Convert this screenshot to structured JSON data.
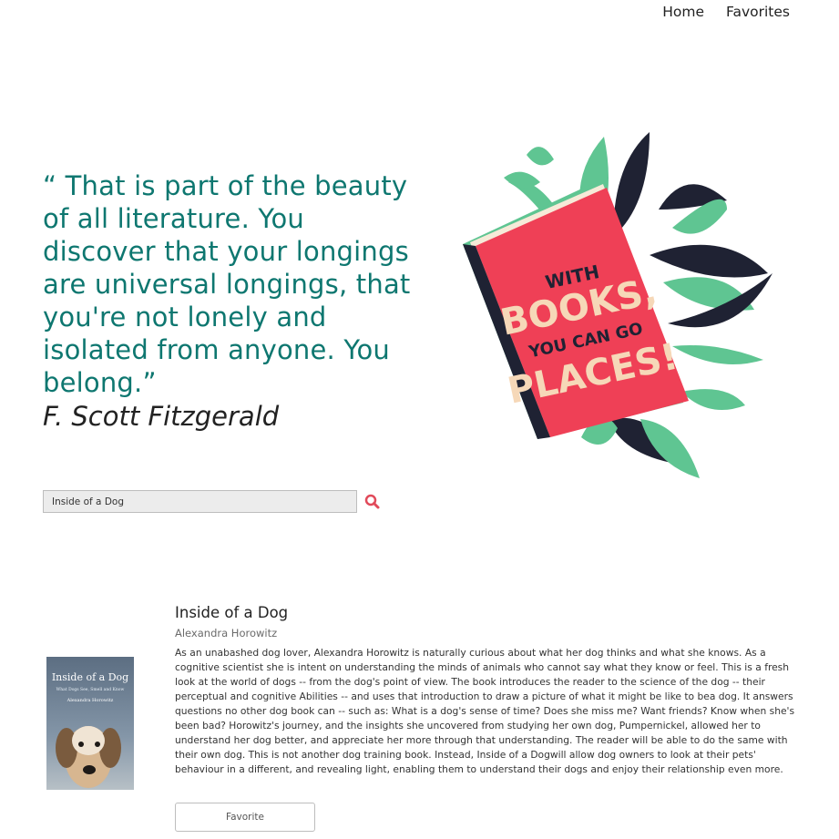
{
  "nav": {
    "home_label": "Home",
    "favorites_label": "Favorites"
  },
  "hero": {
    "quote": "“ That is part of the beauty of all literature. You discover that your longings are universal longings, that you're not lonely and isolated from anyone. You belong.”",
    "author": "F. Scott Fitzgerald",
    "illustration_text": [
      "WITH",
      "BOOKS,",
      "YOU CAN GO",
      "PLACES!"
    ]
  },
  "search": {
    "value": "Inside of a Dog",
    "icon": "search-icon"
  },
  "result": {
    "title": "Inside of a Dog",
    "author": "Alexandra Horowitz",
    "cover_title": "Inside of a Dog",
    "cover_subtitle": "What Dogs See, Smell and Know",
    "cover_author": "Alexandra Horowitz",
    "description": "As an unabashed dog lover, Alexandra Horowitz is naturally curious about what her dog thinks and what she knows. As a cognitive scientist she is intent on understanding the minds of animals who cannot say what they know or feel. This is a fresh look at the world of dogs -- from the dog's point of view. The book introduces the reader to the science of the dog -- their perceptual and cognitive Abilities -- and uses that introduction to draw a picture of what it might be like to bea dog. It answers questions no other dog book can -- such as: What is a dog's sense of time? Does she miss me? Want friends? Know when she's been bad? Horowitz's journey, and the insights she uncovered from studying her own dog, Pumpernickel, allowed her to understand her dog better, and appreciate her more through that understanding. The reader will be able to do the same with their own dog. This is not another dog training book. Instead, Inside of a Dogwill allow dog owners to look at their pets' behaviour in a different, and revealing light, enabling them to understand their dogs and enjoy their relationship even more.",
    "favorite_label": "Favorite"
  },
  "colors": {
    "accent": "#0e7770",
    "book_red": "#ef4056",
    "leaf_green": "#5fc592",
    "leaf_dark": "#1f2233"
  }
}
